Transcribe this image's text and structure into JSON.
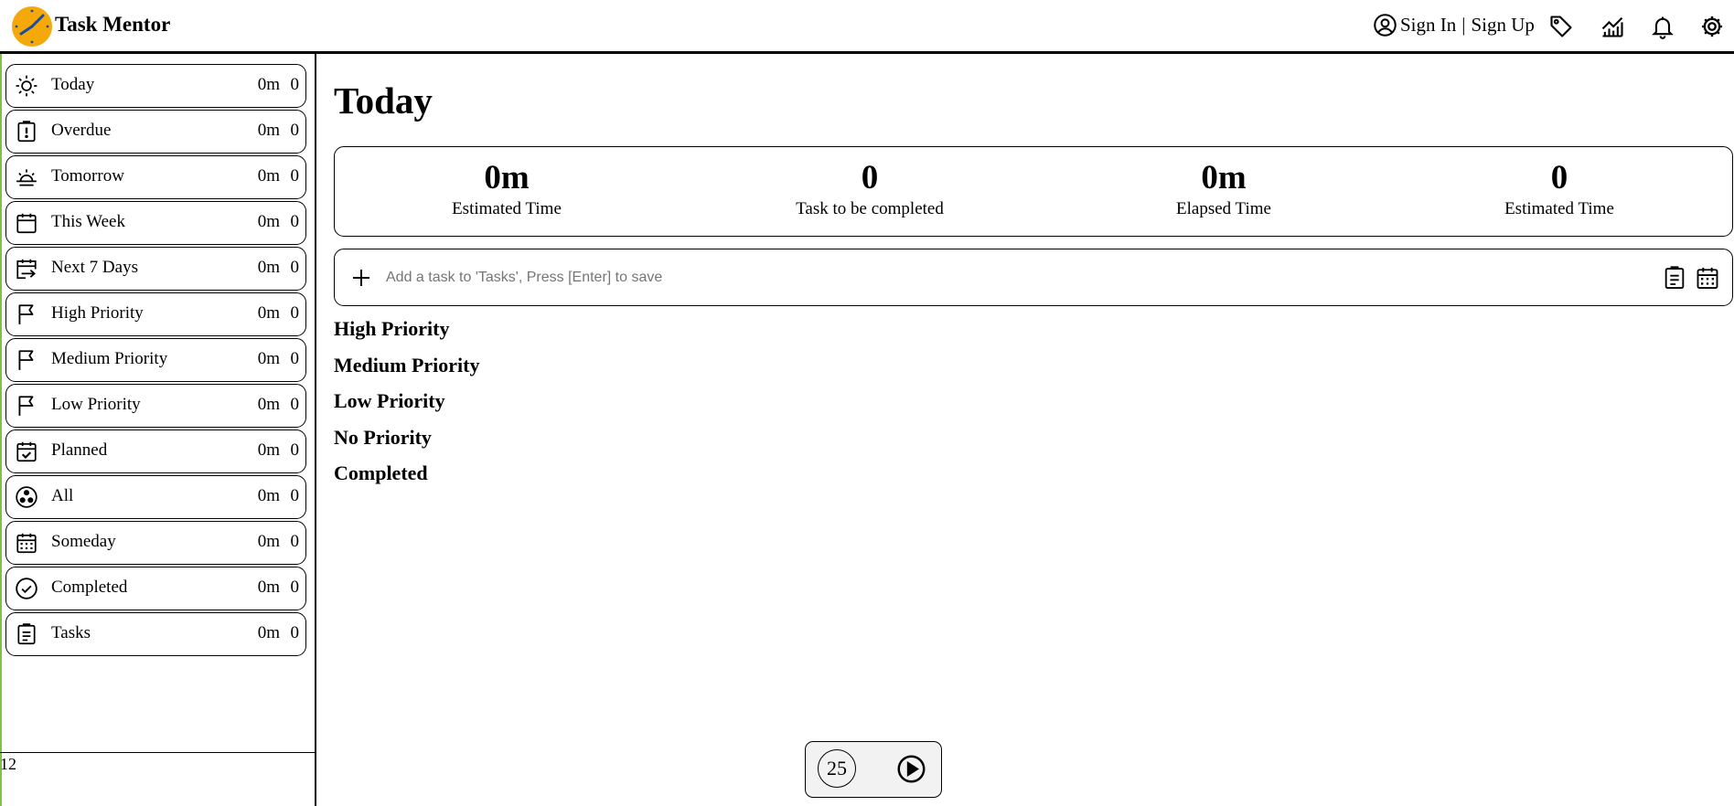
{
  "app": {
    "title": "Task Mentor"
  },
  "header": {
    "sign_in": "Sign In",
    "separator": "|",
    "sign_up": "Sign Up",
    "icons": [
      "user-circle-icon",
      "tag-icon",
      "chart-icon",
      "bell-icon",
      "gear-icon"
    ],
    "logo_colors": {
      "face": "#f5a80a",
      "hands": "#1a4fa0"
    }
  },
  "sidebar": {
    "items": [
      {
        "label": "Today",
        "time": "0m",
        "count": "0",
        "icon": "sun-icon"
      },
      {
        "label": "Overdue",
        "time": "0m",
        "count": "0",
        "icon": "clipboard-alert-icon"
      },
      {
        "label": "Tomorrow",
        "time": "0m",
        "count": "0",
        "icon": "sunrise-icon"
      },
      {
        "label": "This Week",
        "time": "0m",
        "count": "0",
        "icon": "calendar-icon"
      },
      {
        "label": "Next 7 Days",
        "time": "0m",
        "count": "0",
        "icon": "calendar-arrow-icon"
      },
      {
        "label": "High Priority",
        "time": "0m",
        "count": "0",
        "icon": "flag-icon"
      },
      {
        "label": "Medium Priority",
        "time": "0m",
        "count": "0",
        "icon": "flag-icon"
      },
      {
        "label": "Low Priority",
        "time": "0m",
        "count": "0",
        "icon": "flag-icon"
      },
      {
        "label": "Planned",
        "time": "0m",
        "count": "0",
        "icon": "calendar-check-icon"
      },
      {
        "label": "All",
        "time": "0m",
        "count": "0",
        "icon": "circle-dots-icon"
      },
      {
        "label": "Someday",
        "time": "0m",
        "count": "0",
        "icon": "calendar-grid-icon"
      },
      {
        "label": "Completed",
        "time": "0m",
        "count": "0",
        "icon": "check-circle-icon"
      },
      {
        "label": "Tasks",
        "time": "0m",
        "count": "0",
        "icon": "clipboard-list-icon"
      }
    ],
    "footer_text": "12"
  },
  "main": {
    "title": "Today",
    "stats": [
      {
        "value": "0m",
        "label": "Estimated Time"
      },
      {
        "value": "0",
        "label": "Task to be completed"
      },
      {
        "value": "0m",
        "label": "Elapsed Time"
      },
      {
        "value": "0",
        "label": "Estimated Time"
      }
    ],
    "add_task": {
      "placeholder": "Add a task to 'Tasks', Press [Enter] to save",
      "value": ""
    },
    "groups": [
      "High Priority",
      "Medium Priority",
      "Low Priority",
      "No Priority",
      "Completed"
    ]
  },
  "pomodoro": {
    "minutes": "25"
  }
}
